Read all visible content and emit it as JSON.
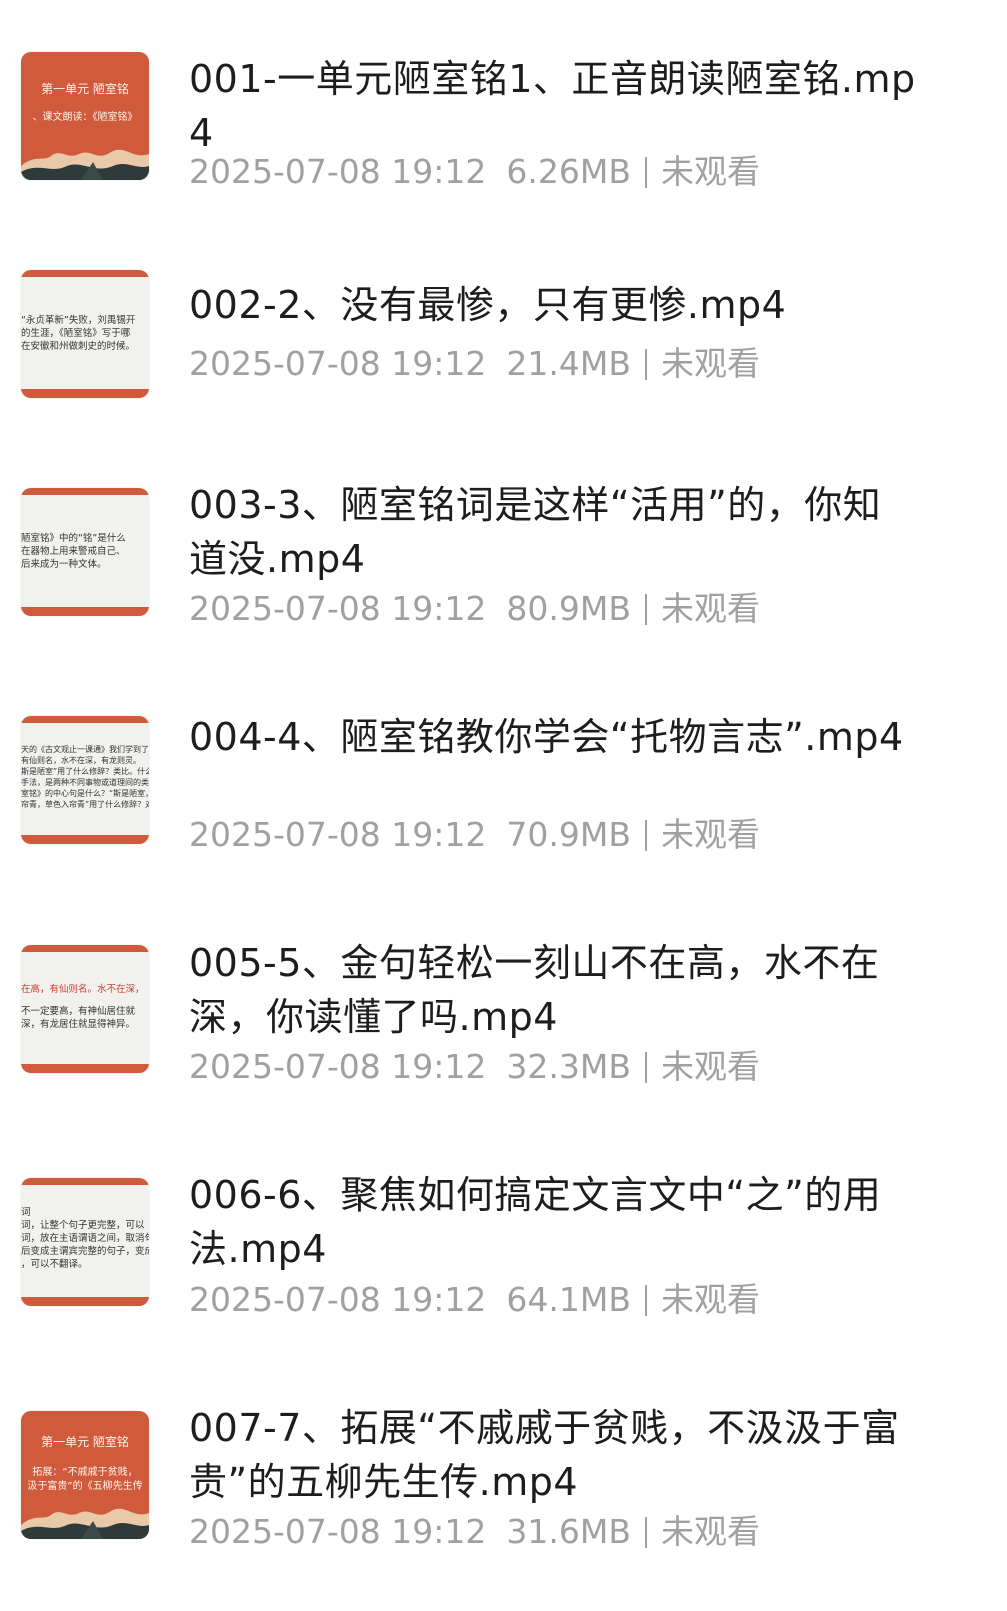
{
  "files": [
    {
      "title": "001-一单元陋室铭1、正音朗读陋室铭.mp4",
      "date": "2025-07-08 19:12",
      "size": "6.26MB",
      "status": "未观看",
      "thumb_style": "red",
      "thumb_lines": [
        "第一单元 陋室铭",
        "、课文朗读：《陋室铭》"
      ]
    },
    {
      "title": "002-2、没有最惨，只有更惨.mp4",
      "date": "2025-07-08 19:12",
      "size": "21.4MB",
      "status": "未观看",
      "thumb_style": "paper",
      "thumb_lines": [
        "“永贞革新”失败，刘禹锡开",
        "的生涯，《陋室铭》写于哪",
        "在安徽和州做刺史的时候。"
      ]
    },
    {
      "title": "003-3、陋室铭词是这样“活用”的，你知道没.mp4",
      "date": "2025-07-08 19:12",
      "size": "80.9MB",
      "status": "未观看",
      "thumb_style": "paper",
      "thumb_lines": [
        "陋室铭》中的“铭”是什么",
        "在器物上用来警戒自己、",
        "后来成为一种文体。"
      ]
    },
    {
      "title": "004-4、陋室铭教你学会“托物言志”.mp4",
      "date": "2025-07-08 19:12",
      "size": "70.9MB",
      "status": "未观看",
      "thumb_style": "paper",
      "thumb_lines": [
        "天的《古文观止一课通》我们学到了这",
        "有仙则名，水不在深，有龙则灵。",
        "斯是陋室”用了什么修辞？类比。什么叫",
        "手法，是两种不同事物或道理间的类比",
        "室铭》的中心句是什么？“斯是陋室，",
        "帘青，草色入帘青”用了什么修辞？对偶"
      ]
    },
    {
      "title": "005-5、金句轻松一刻山不在高，水不在深，你读懂了吗.mp4",
      "date": "2025-07-08 19:12",
      "size": "32.3MB",
      "status": "未观看",
      "thumb_style": "paper",
      "thumb_lines": [
        "在高，有仙则名。水不在深，",
        "不一定要高，有神仙居住就",
        "深，有龙居住就显得神异。"
      ]
    },
    {
      "title": "006-6、聚焦如何搞定文言文中“之”的用法.mp4",
      "date": "2025-07-08 19:12",
      "size": "64.1MB",
      "status": "未观看",
      "thumb_style": "paper",
      "thumb_lines": [
        "词",
        "词，让整个句子更完整，可以",
        "词，放在主语谓语之间，取消句",
        "后变成主谓宾完整的句子，变成",
        "，可以不翻译。"
      ]
    },
    {
      "title": "007-7、拓展“不戚戚于贫贱，不汲汲于富贵”的五柳先生传.mp4",
      "date": "2025-07-08 19:12",
      "size": "31.6MB",
      "status": "未观看",
      "thumb_style": "red",
      "thumb_lines": [
        "第一单元 陋室铭",
        "拓展：“不戚戚于贫贱，",
        "汲于富贵”的《五柳先生传"
      ]
    }
  ]
}
